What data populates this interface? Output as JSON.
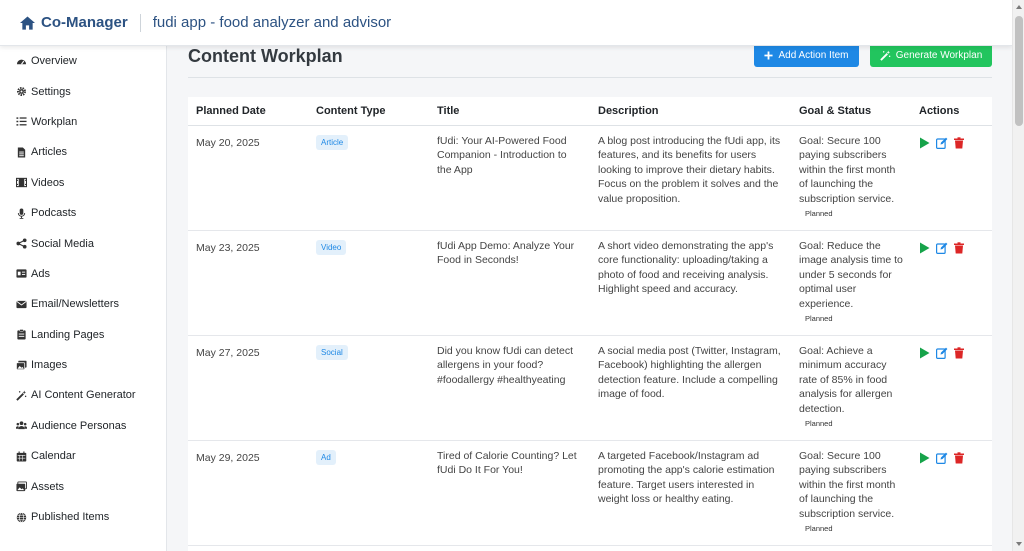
{
  "header": {
    "brand": "Co-Manager",
    "app_title": "fudi app - food analyzer and advisor",
    "icon": "home-icon"
  },
  "sidebar": {
    "items": [
      {
        "label": "Overview",
        "icon": "dashboard-icon"
      },
      {
        "label": "Settings",
        "icon": "gear-icon"
      },
      {
        "label": "Workplan",
        "icon": "list-icon"
      },
      {
        "label": "Articles",
        "icon": "document-icon"
      },
      {
        "label": "Videos",
        "icon": "film-icon"
      },
      {
        "label": "Podcasts",
        "icon": "microphone-icon"
      },
      {
        "label": "Social Media",
        "icon": "share-icon"
      },
      {
        "label": "Ads",
        "icon": "ad-icon"
      },
      {
        "label": "Email/Newsletters",
        "icon": "envelope-icon"
      },
      {
        "label": "Landing Pages",
        "icon": "clipboard-icon"
      },
      {
        "label": "Images",
        "icon": "images-icon"
      },
      {
        "label": "AI Content Generator",
        "icon": "magic-wand-icon"
      },
      {
        "label": "Audience Personas",
        "icon": "users-icon"
      },
      {
        "label": "Calendar",
        "icon": "calendar-icon"
      },
      {
        "label": "Assets",
        "icon": "photo-icon"
      },
      {
        "label": "Published Items",
        "icon": "globe-icon"
      }
    ]
  },
  "main": {
    "title": "Content Workplan",
    "add_button": "Add Action Item",
    "generate_button": "Generate Workplan",
    "colors": {
      "add": "#1e88e5",
      "generate": "#22c55e",
      "play": "#16a34a",
      "edit": "#1e88e5",
      "delete": "#dc2626"
    }
  },
  "table": {
    "headers": [
      "Planned Date",
      "Content Type",
      "Title",
      "Description",
      "Goal & Status",
      "Actions"
    ],
    "rows": [
      {
        "date": "May 20, 2025",
        "type": "Article",
        "title": "fUdi: Your AI-Powered Food Companion - Introduction to the App",
        "description": "A blog post introducing the fUdi app, its features, and its benefits for users looking to improve their dietary habits. Focus on the problem it solves and the value proposition.",
        "goal": "Goal: Secure 100 paying subscribers within the first month of launching the subscription service.",
        "status": "Planned"
      },
      {
        "date": "May 23, 2025",
        "type": "Video",
        "title": "fUdi App Demo: Analyze Your Food in Seconds!",
        "description": "A short video demonstrating the app's core functionality: uploading/taking a photo of food and receiving analysis. Highlight speed and accuracy.",
        "goal": "Goal: Reduce the image analysis time to under 5 seconds for optimal user experience.",
        "status": "Planned"
      },
      {
        "date": "May 27, 2025",
        "type": "Social",
        "title": "Did you know fUdi can detect allergens in your food? #foodallergy #healthyeating",
        "description": "A social media post (Twitter, Instagram, Facebook) highlighting the allergen detection feature. Include a compelling image of food.",
        "goal": "Goal: Achieve a minimum accuracy rate of 85% in food analysis for allergen detection.",
        "status": "Planned"
      },
      {
        "date": "May 29, 2025",
        "type": "Ad",
        "title": "Tired of Calorie Counting? Let fUdi Do It For You!",
        "description": "A targeted Facebook/Instagram ad promoting the app's calorie estimation feature. Target users interested in weight loss or healthy eating.",
        "goal": "Goal: Secure 100 paying subscribers within the first month of launching the subscription service.",
        "status": "Planned"
      }
    ]
  }
}
